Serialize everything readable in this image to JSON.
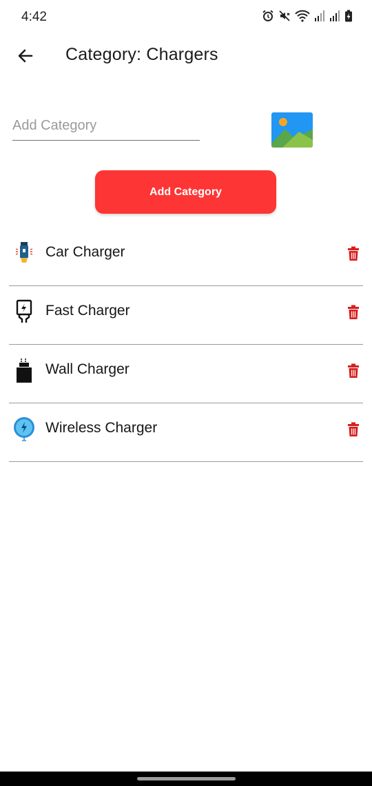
{
  "status_bar": {
    "time": "4:42",
    "icons": [
      "alarm-icon",
      "mute-icon",
      "wifi-icon",
      "signal-icon",
      "signal-icon",
      "battery-charging-icon"
    ]
  },
  "app_bar": {
    "back_icon": "arrow-back-icon",
    "title": "Category: Chargers"
  },
  "form": {
    "input_value": "",
    "input_placeholder": "Add Category",
    "image_picker_icon": "image-icon",
    "add_button_label": "Add Category"
  },
  "categories": [
    {
      "label": "Car Charger",
      "icon": "car-charger-icon"
    },
    {
      "label": "Fast Charger",
      "icon": "fast-charger-icon"
    },
    {
      "label": "Wall Charger",
      "icon": "wall-charger-icon"
    },
    {
      "label": "Wireless Charger",
      "icon": "wireless-charger-icon"
    }
  ],
  "colors": {
    "accent": "#fd3535",
    "delete": "#d81e1e",
    "divider": "#9b9b9b"
  }
}
